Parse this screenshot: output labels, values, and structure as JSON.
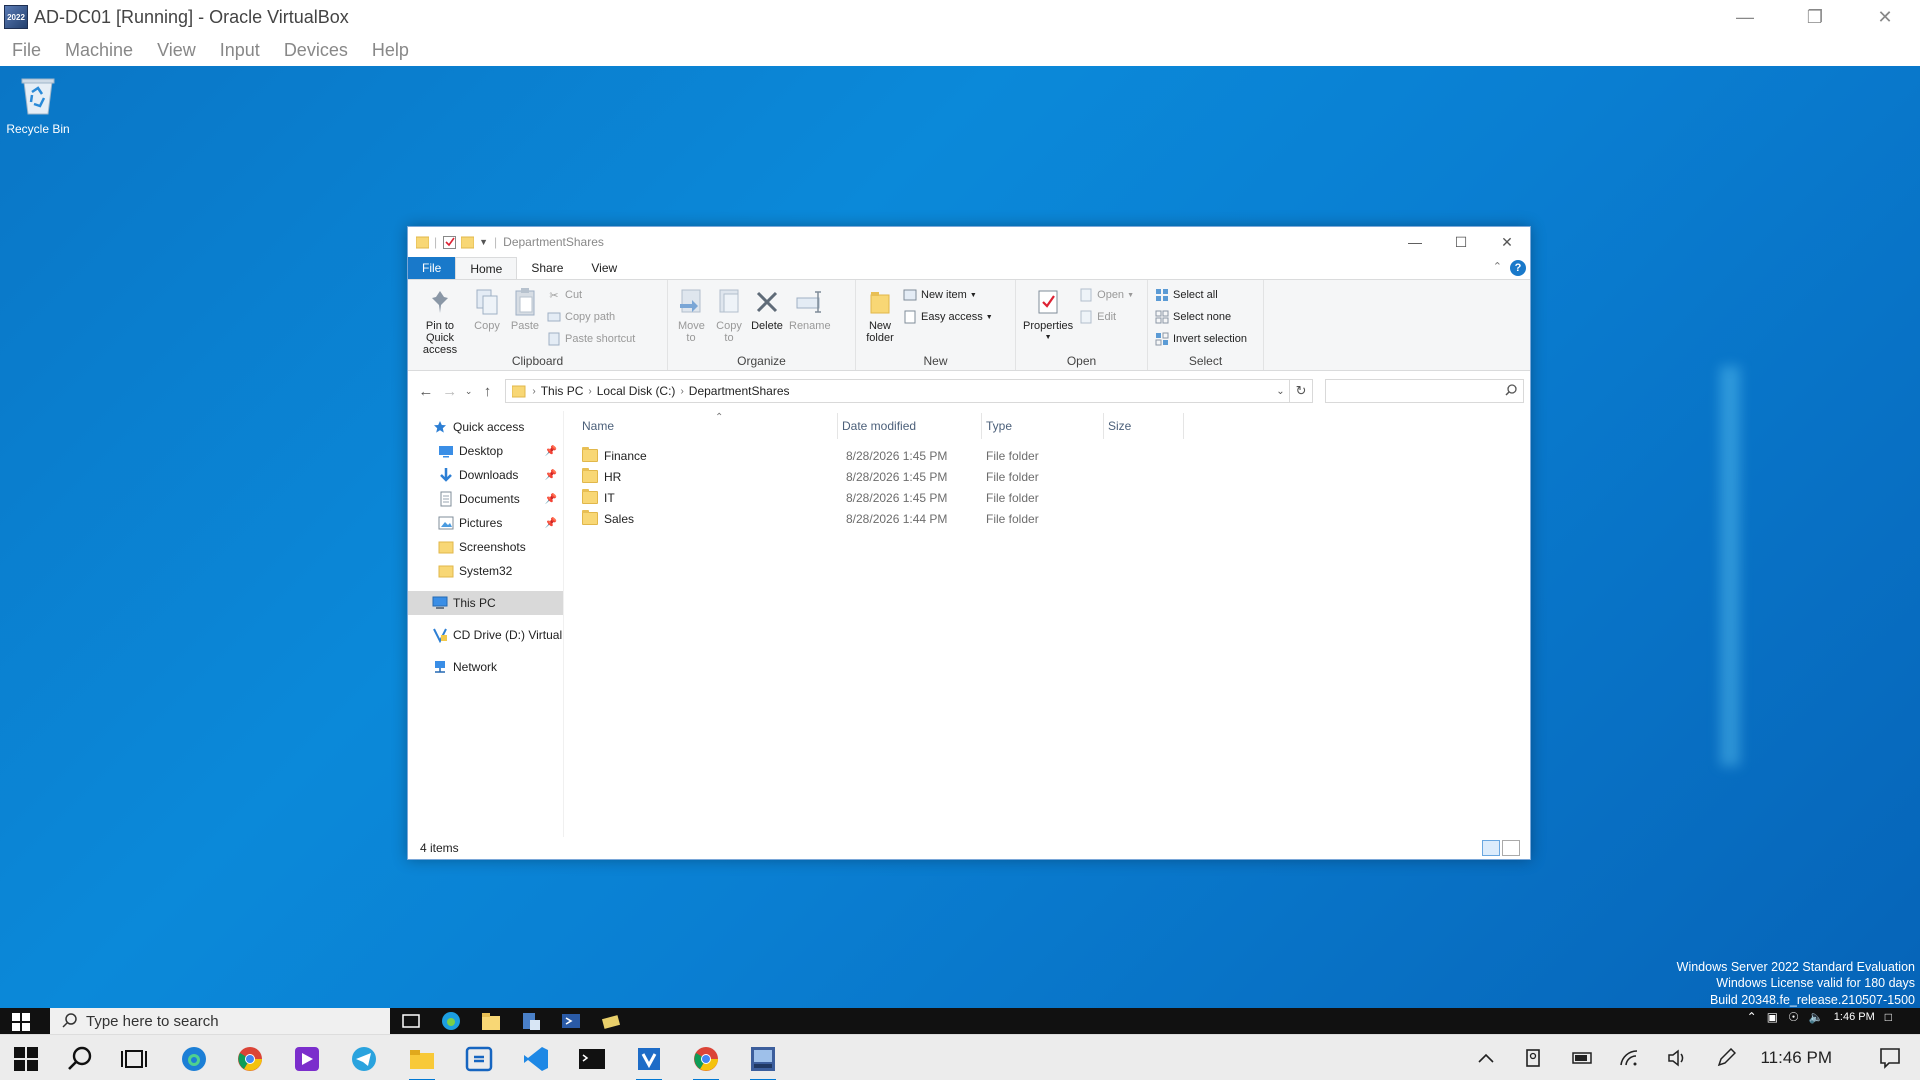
{
  "vbox": {
    "title": "AD-DC01 [Running] - Oracle VirtualBox",
    "icon_text": "2022",
    "menu": [
      "File",
      "Machine",
      "View",
      "Input",
      "Devices",
      "Help"
    ]
  },
  "desktop": {
    "recycle_bin_label": "Recycle Bin",
    "watermark": {
      "line1": "Windows Server 2022 Standard Evaluation",
      "line2": "Windows License valid for 180 days",
      "line3": "Build 20348.fe_release.210507-1500"
    }
  },
  "explorer": {
    "title": "DepartmentShares",
    "tabs": {
      "file": "File",
      "home": "Home",
      "share": "Share",
      "view": "View"
    },
    "help": "?",
    "ribbon": {
      "clipboard": {
        "label": "Clipboard",
        "pin": "Pin to Quick access",
        "copy": "Copy",
        "paste": "Paste",
        "cut": "Cut",
        "copy_path": "Copy path",
        "paste_shortcut": "Paste shortcut"
      },
      "organize": {
        "label": "Organize",
        "move_to": "Move to",
        "copy_to": "Copy to",
        "delete": "Delete",
        "rename": "Rename"
      },
      "new": {
        "label": "New",
        "new_folder": "New folder",
        "new_item": "New item",
        "easy_access": "Easy access"
      },
      "open": {
        "label": "Open",
        "properties": "Properties",
        "open": "Open",
        "edit": "Edit"
      },
      "select": {
        "label": "Select",
        "select_all": "Select all",
        "select_none": "Select none",
        "invert": "Invert selection"
      }
    },
    "breadcrumb": [
      "This PC",
      "Local Disk (C:)",
      "DepartmentShares"
    ],
    "search_placeholder": "",
    "nav": {
      "quick_access": "Quick access",
      "items": [
        {
          "label": "Desktop",
          "pinned": true
        },
        {
          "label": "Downloads",
          "pinned": true
        },
        {
          "label": "Documents",
          "pinned": true
        },
        {
          "label": "Pictures",
          "pinned": true
        },
        {
          "label": "Screenshots",
          "pinned": false
        },
        {
          "label": "System32",
          "pinned": false
        }
      ],
      "this_pc": "This PC",
      "cd_drive": "CD Drive (D:) VirtualB",
      "network": "Network"
    },
    "columns": {
      "name": "Name",
      "date": "Date modified",
      "type": "Type",
      "size": "Size"
    },
    "files": [
      {
        "name": "Finance",
        "date": "8/28/2026 1:45 PM",
        "type": "File folder",
        "size": ""
      },
      {
        "name": "HR",
        "date": "8/28/2026 1:45 PM",
        "type": "File folder",
        "size": ""
      },
      {
        "name": "IT",
        "date": "8/28/2026 1:45 PM",
        "type": "File folder",
        "size": ""
      },
      {
        "name": "Sales",
        "date": "8/28/2026 1:44 PM",
        "type": "File folder",
        "size": ""
      }
    ],
    "status": "4 items"
  },
  "guest_taskbar": {
    "search_text": "Type here to search",
    "time": "1:46 PM"
  },
  "host_taskbar": {
    "clock": "11:46 PM"
  }
}
